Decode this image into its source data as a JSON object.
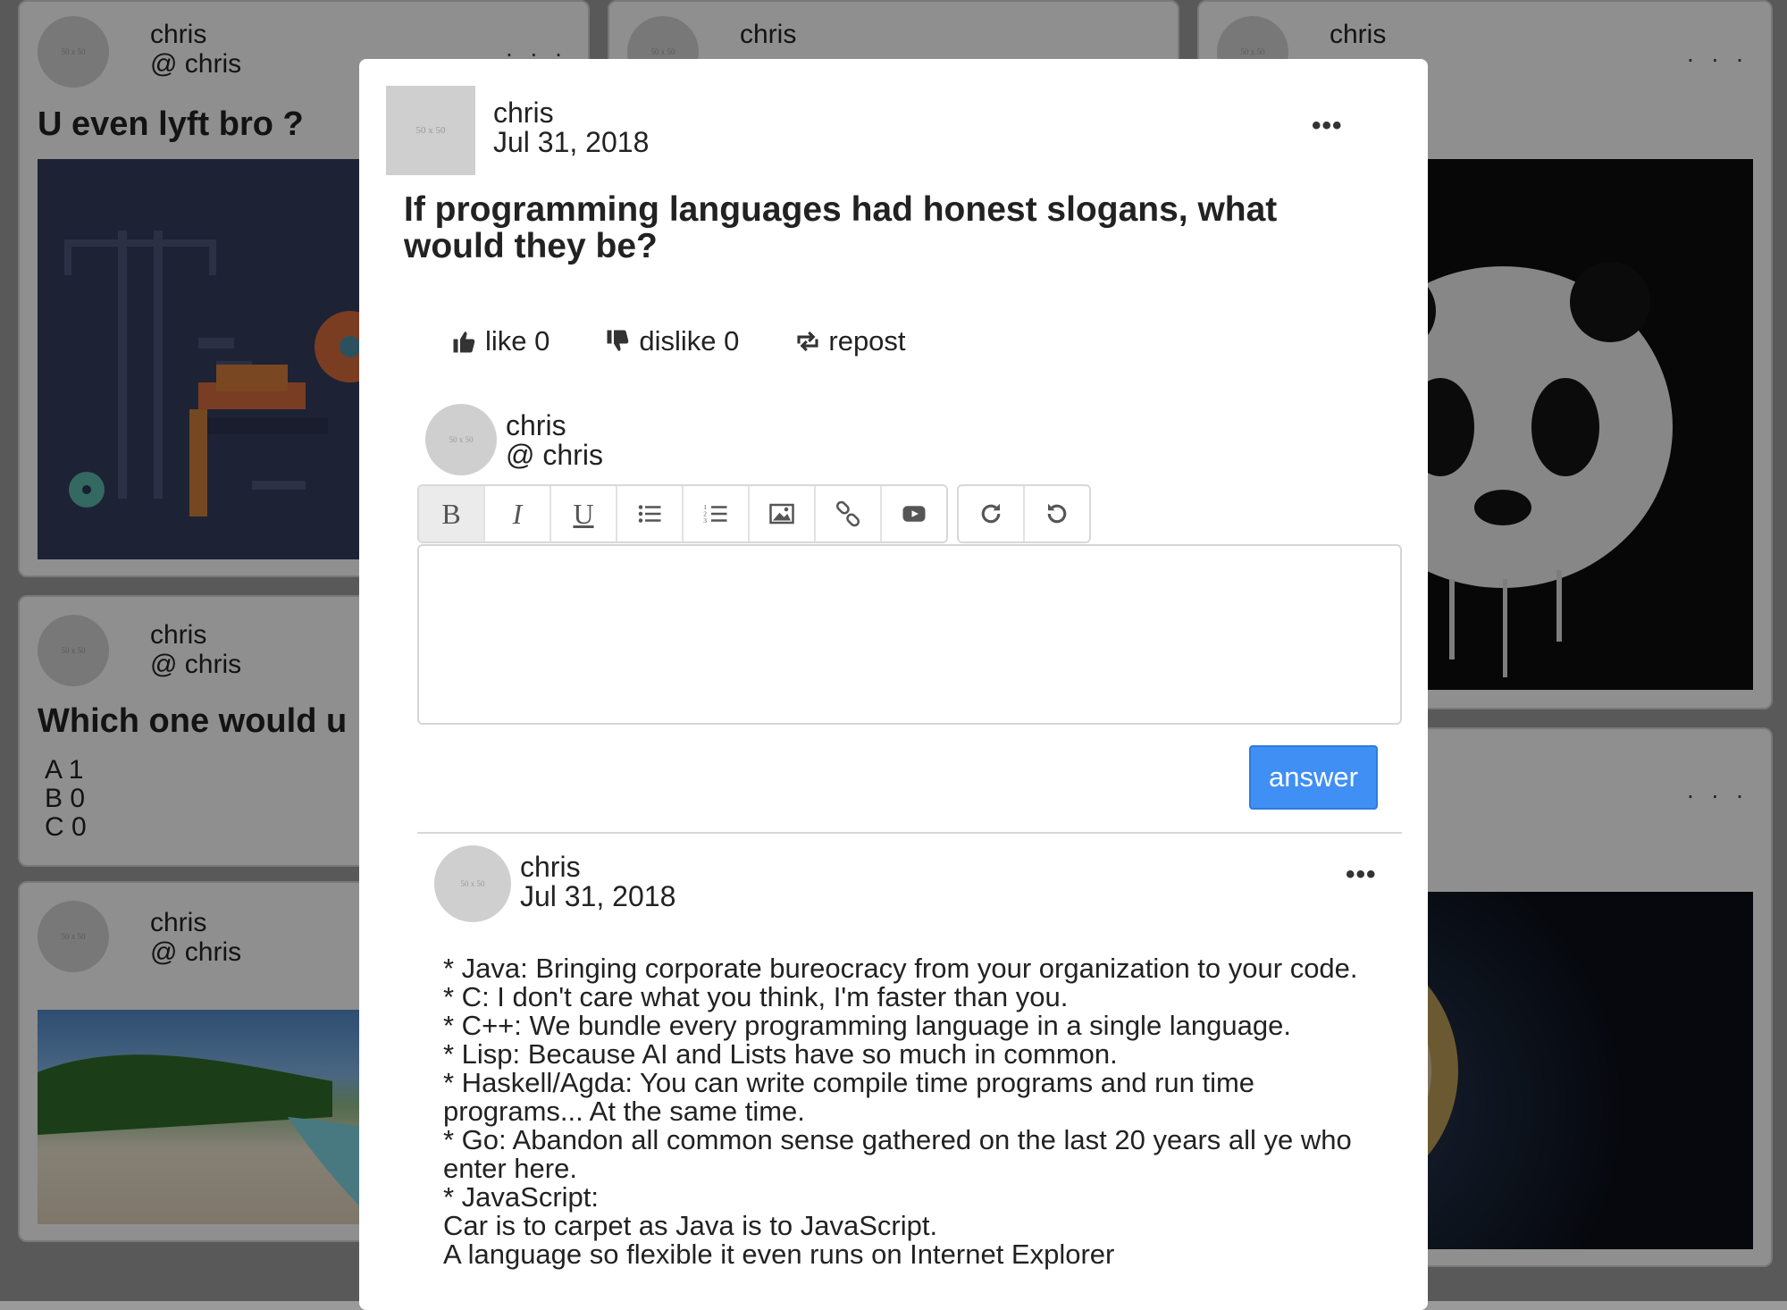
{
  "cards": [
    {
      "name": "chris",
      "handle": "@ chris",
      "title": "U even lyft bro ?",
      "avatar_text": "50 x 50"
    },
    {
      "name": "chris",
      "handle": "@ chris",
      "title": "Which one would u",
      "avatar_text": "50 x 50",
      "poll": [
        {
          "option": "A",
          "count": "1"
        },
        {
          "option": "B",
          "count": "0"
        },
        {
          "option": "C",
          "count": "0"
        }
      ]
    },
    {
      "name": "chris",
      "handle": "@ chris",
      "avatar_text": "50 x 50"
    },
    {
      "name": "chris",
      "handle": "@ chris",
      "avatar_text": "50 x 50"
    },
    {
      "name": "chris",
      "handle": "@ chris",
      "avatar_text": "50 x 50"
    }
  ],
  "card_menu": ". . .",
  "modal": {
    "avatar_text": "50 x 50",
    "author": "chris",
    "date": "Jul 31, 2018",
    "menu": "•••",
    "title": "If programming languages had honest slogans, what would they be?",
    "actions": {
      "like": "like 0",
      "dislike": "dislike 0",
      "repost": "repost"
    },
    "composer": {
      "name": "chris",
      "handle": "@ chris",
      "avatar_text": "50 x 50"
    },
    "toolbar": {
      "bold": "B",
      "italic": "I",
      "underline": "U",
      "icons": [
        "unordered-list-icon",
        "ordered-list-icon",
        "image-icon",
        "link-icon",
        "video-icon",
        "redo-icon",
        "undo-icon"
      ]
    },
    "answer_button": "answer",
    "answer": {
      "author": "chris",
      "date": "Jul 31, 2018",
      "avatar_text": "50 x 50",
      "menu": "•••",
      "lines": [
        "* Java: Bringing corporate bureocracy from your organization to your code.",
        "* C: I don't care what you think, I'm faster than you.",
        "* C++: We bundle every programming language in a single language.",
        "* Lisp: Because AI and Lists have so much in common.",
        "* Haskell/Agda: You can write compile time programs and run time programs... At the same time.",
        "* Go: Abandon all common sense gathered on the last 20 years all ye who enter here.",
        "* JavaScript:",
        "Car is to carpet as Java is to JavaScript.",
        "A language so flexible it even runs on Internet Explorer"
      ]
    }
  },
  "colors": {
    "accent": "#3f8ff4",
    "overlay": "rgba(0,0,0,0.42)"
  }
}
